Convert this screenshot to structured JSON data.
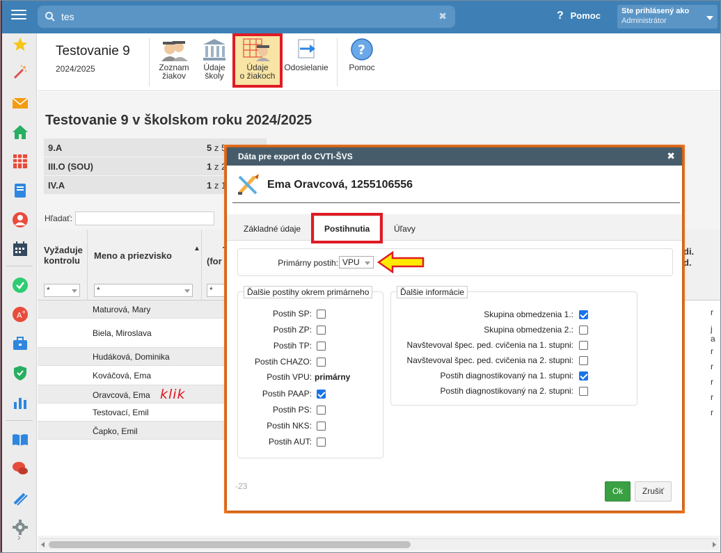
{
  "topbar": {
    "search_value": "tes",
    "clear_glyph": "✖",
    "help_label": "Pomoc",
    "user_line1": "Ste prihlásený ako",
    "user_line2": "Administrátor"
  },
  "header": {
    "title": "Testovanie 9",
    "year": "2024/2025",
    "toolbar": [
      {
        "line1": "Zoznam",
        "line2": "žiakov"
      },
      {
        "line1": "Údaje",
        "line2": "školy"
      },
      {
        "line1": "Údaje",
        "line2": "o žiakoch"
      },
      {
        "line1": "Odosielanie",
        "line2": ""
      },
      {
        "line1": "Pomoc",
        "line2": ""
      }
    ]
  },
  "content": {
    "title": "Testovanie 9 v školskom roku 2024/2025",
    "classes": [
      {
        "name": "9.A",
        "count_bold": "5",
        "count_rest": "z 5"
      },
      {
        "name": "III.O (SOU)",
        "count_bold": "1",
        "count_rest": "z 2"
      },
      {
        "name": "IV.A",
        "count_bold": "1",
        "count_rest": "z 1"
      }
    ],
    "search_label": "Hľadať:",
    "grid": {
      "col1": "Vyžaduje kontrolu",
      "col2": "Meno a priezvisko",
      "col3": "(for",
      "col3_top": "T",
      "col_right": "di.",
      "col_right2": "d.",
      "filter1": "*",
      "filter2": "*",
      "filter3": "*",
      "rows": [
        "Maturová, Mary",
        "Biela, Miroslava",
        "Hudáková, Dominika",
        "Kováčová, Ema",
        "Oravcová, Ema",
        "Testovací, Emil",
        "Čapko, Emil"
      ],
      "right_bits": [
        "r",
        "j",
        "a",
        "r",
        "r",
        "r",
        "r",
        "r"
      ]
    },
    "annotation": "klik"
  },
  "dialog": {
    "title": "Dáta pre export do CVTI-ŠVS",
    "close": "✖",
    "person": "Ema Oravcová, 1255106556",
    "tabs": [
      "Základné údaje",
      "Postihnutia",
      "Úľavy"
    ],
    "primary_label": "Primárny postih:",
    "primary_value": "VPU",
    "left_legend": "Ďalšie postihy okrem primárneho",
    "left_items": [
      {
        "label": "Postih SP:",
        "checked": false
      },
      {
        "label": "Postih ZP:",
        "checked": false
      },
      {
        "label": "Postih TP:",
        "checked": false
      },
      {
        "label": "Postih CHAZO:",
        "checked": false
      },
      {
        "label": "Postih VPU:",
        "checked": null,
        "text": "primárny"
      },
      {
        "label": "Postih PAAP:",
        "checked": true
      },
      {
        "label": "Postih PS:",
        "checked": false
      },
      {
        "label": "Postih NKS:",
        "checked": false
      },
      {
        "label": "Postih AUT:",
        "checked": false
      }
    ],
    "right_legend": "Ďalšie informácie",
    "right_items": [
      {
        "label": "Skupina obmedzenia 1.:",
        "checked": true
      },
      {
        "label": "Skupina obmedzenia 2.:",
        "checked": false
      },
      {
        "label": "Navštevoval špec. ped. cvičenia na 1. stupni:",
        "checked": false
      },
      {
        "label": "Navštevoval špec. ped. cvičenia na 2. stupni:",
        "checked": false
      },
      {
        "label": "Postih diagnostikovaný na 1. stupni:",
        "checked": true
      },
      {
        "label": "Postih diagnostikovaný na 2. stupni:",
        "checked": false
      }
    ],
    "footer_hint": "-23",
    "ok_label": "Ok",
    "cancel_label": "Zrušiť"
  },
  "colors": {
    "topbar": "#3e80b6",
    "dialog_title": "#475c6b",
    "highlight_red": "#e01b24",
    "highlight_orange": "#f4761f",
    "arrow_yellow": "#ffea00",
    "ok_green": "#3aa043"
  }
}
